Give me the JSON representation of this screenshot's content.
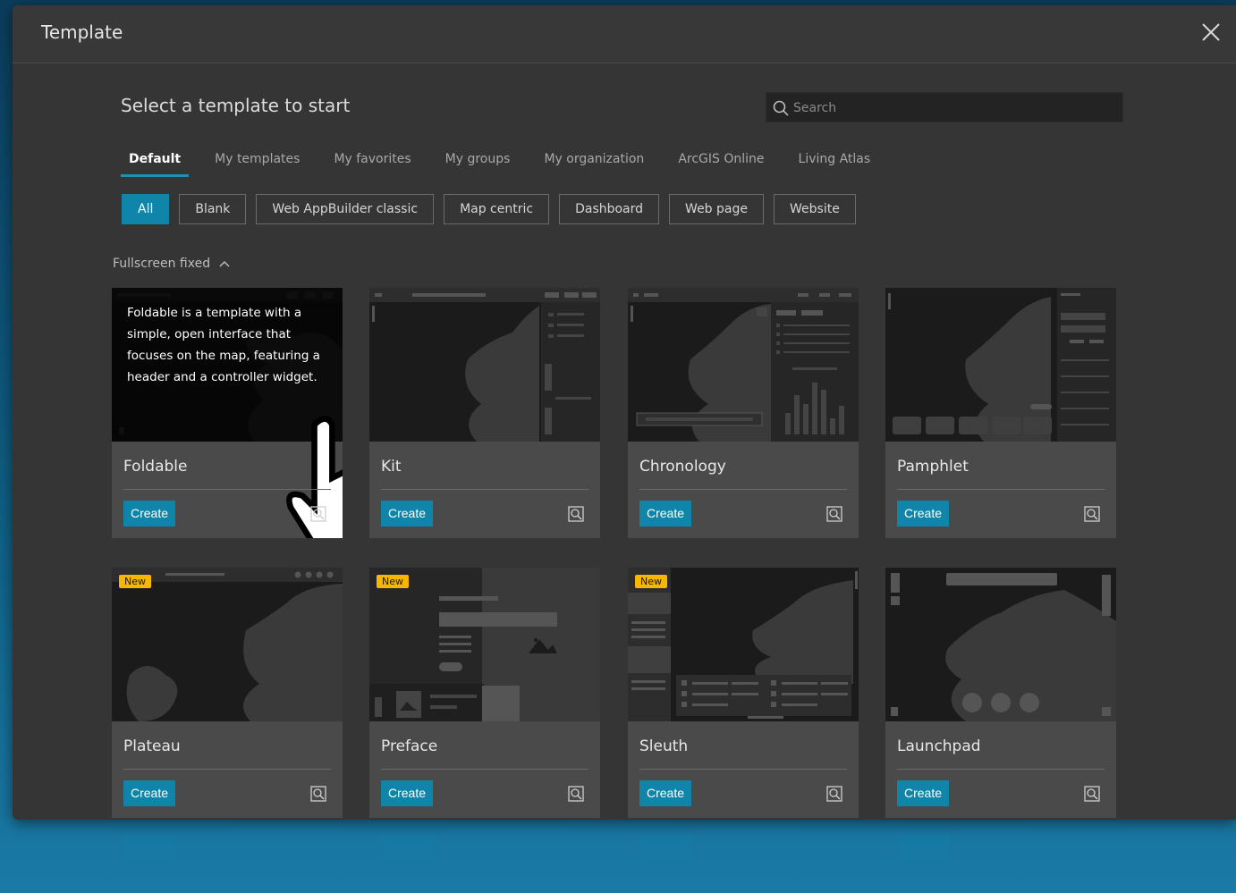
{
  "window": {
    "title": "Template"
  },
  "main": {
    "heading": "Select a template to start",
    "search_placeholder": "Search",
    "tabs": [
      {
        "label": "Default",
        "active": true
      },
      {
        "label": "My templates"
      },
      {
        "label": "My favorites"
      },
      {
        "label": "My groups"
      },
      {
        "label": "My organization"
      },
      {
        "label": "ArcGIS Online"
      },
      {
        "label": "Living Atlas"
      }
    ],
    "filters": [
      {
        "label": "All",
        "active": true
      },
      {
        "label": "Blank"
      },
      {
        "label": "Web AppBuilder classic"
      },
      {
        "label": "Map centric"
      },
      {
        "label": "Dashboard"
      },
      {
        "label": "Web page"
      },
      {
        "label": "Website"
      }
    ],
    "section": {
      "title": "Fullscreen fixed"
    },
    "cards": [
      {
        "name": "Foldable",
        "description": "Foldable is a template with a simple, open interface that focuses on the map, featuring a header and a controller widget.",
        "create_label": "Create"
      },
      {
        "name": "Kit",
        "create_label": "Create"
      },
      {
        "name": "Chronology",
        "create_label": "Create"
      },
      {
        "name": "Pamphlet",
        "create_label": "Create"
      },
      {
        "name": "Plateau",
        "badge": "New",
        "create_label": "Create"
      },
      {
        "name": "Preface",
        "badge": "New",
        "create_label": "Create"
      },
      {
        "name": "Sleuth",
        "badge": "New",
        "create_label": "Create"
      },
      {
        "name": "Launchpad",
        "create_label": "Create"
      }
    ]
  },
  "colors": {
    "accent": "#0f86a9",
    "badge": "#f6b700",
    "panel": "#353535",
    "card": "#4a4a4a"
  },
  "icons": [
    "close-icon",
    "search-icon",
    "chevron-up-icon",
    "preview-icon",
    "hand-cursor-icon"
  ]
}
